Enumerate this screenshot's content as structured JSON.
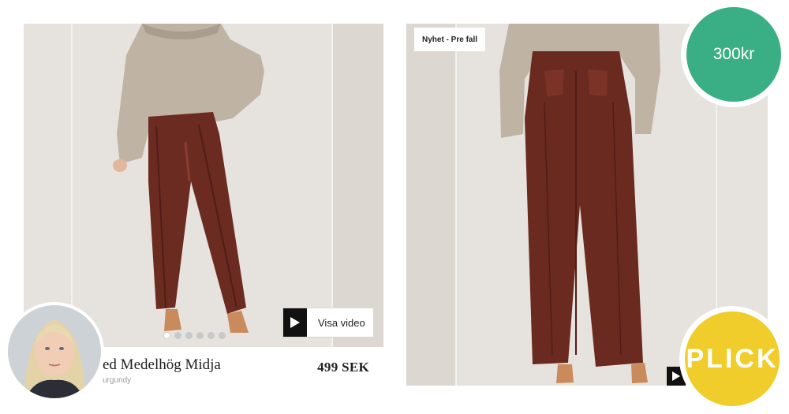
{
  "left_card": {
    "video_button_label": "Visa video",
    "product_name": "ed Medelhög Midja",
    "product_color": "urgundy",
    "price": "499 SEK",
    "carousel": {
      "count": 6,
      "active_index": 0
    }
  },
  "right_card": {
    "badge": "Nyhet - Pre fall"
  },
  "price_bubble": {
    "text": "300kr",
    "color": "#3aaf85"
  },
  "plick_bubble": {
    "text": "PLICK",
    "color": "#f0cd2a"
  },
  "colors": {
    "leather_trousers": "#6a2a20",
    "sweater": "#bdb2a2",
    "background": "#e5e1dd"
  },
  "icons": [
    "play-icon",
    "avatar-photo"
  ]
}
